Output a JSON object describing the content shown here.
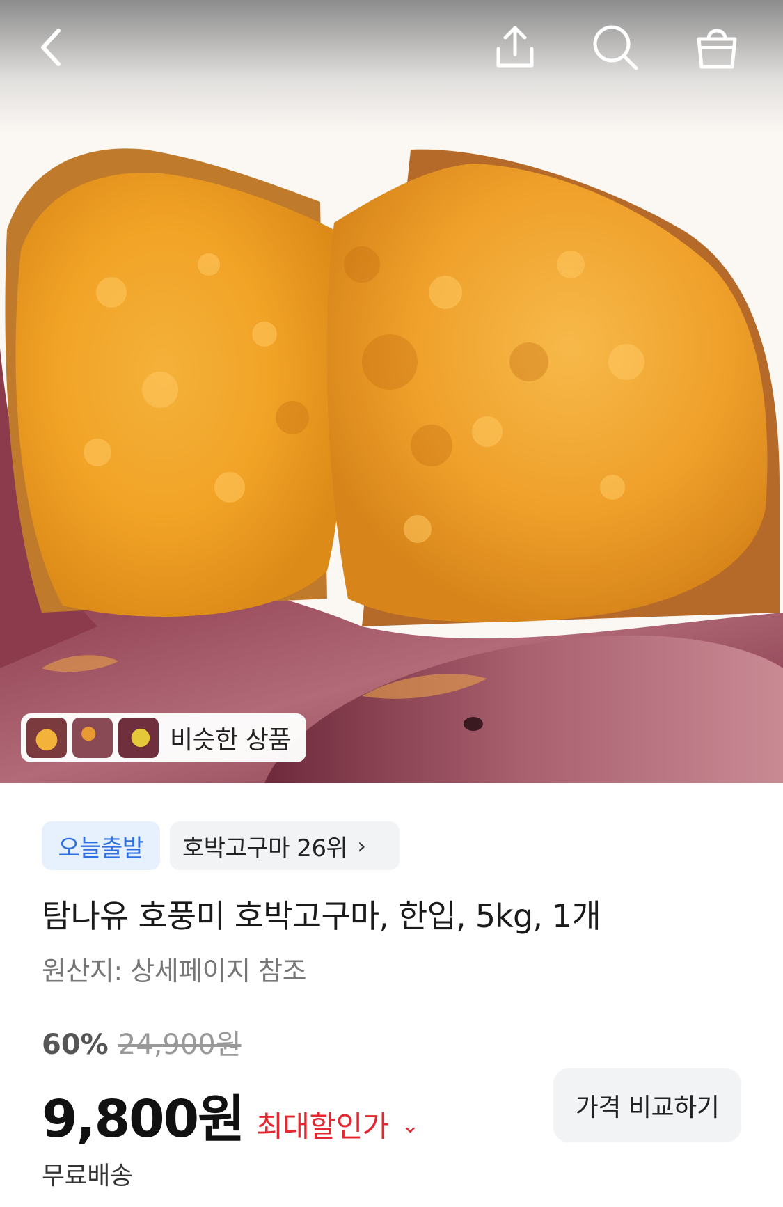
{
  "topbar": {
    "icons": [
      "chevron-left-icon",
      "share-icon",
      "search-icon",
      "shopping-bag-icon"
    ]
  },
  "hero": {
    "image": "roasted sweet potato",
    "similar_products_label": "비슷한 상품"
  },
  "badges": {
    "today_departure": "오늘출발",
    "ranking": "호박고구마 26위"
  },
  "product": {
    "title": "탐나유 호풍미 호박고구마, 한입, 5kg, 1개",
    "origin": "원산지: 상세페이지 참조"
  },
  "pricing": {
    "discount_percent": "60%",
    "original_price": "24,900원",
    "price": "9,800원",
    "max_discount_label": "최대할인가",
    "compare_button": "가격 비교하기",
    "shipping": "무료배송"
  },
  "colors": {
    "accent_red": "#e3262f",
    "badge_blue": "#2f6fe0",
    "badge_blue_bg": "#e7f0fd",
    "chip_gray_bg": "#f2f3f5"
  }
}
